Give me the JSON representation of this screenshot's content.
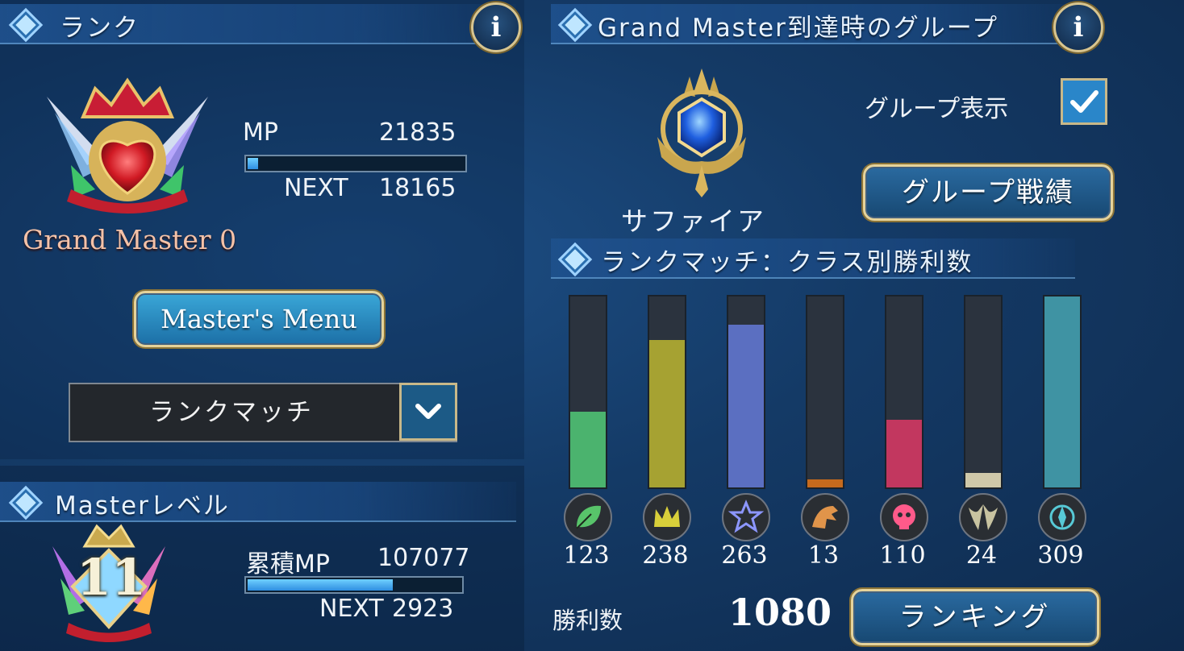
{
  "rank_panel": {
    "title": "ランク",
    "rank_name": "Grand Master 0",
    "mp_label": "MP",
    "mp_value": "21835",
    "mp_progress": 0.05,
    "next_label": "NEXT",
    "next_value": "18165",
    "masters_menu_button": "Master's Menu",
    "match_select_value": "ランクマッチ"
  },
  "master_level": {
    "title": "Masterレベル",
    "level": "11",
    "cumulative_mp_label": "累積MP",
    "cumulative_mp_value": "107077",
    "progress": 0.68,
    "next_label": "NEXT",
    "next_value": "2923"
  },
  "group_panel": {
    "title": "Grand Master到達時のグループ",
    "group_name": "サファイア",
    "group_display_label": "グループ表示",
    "group_display_checked": true,
    "group_record_button": "グループ戦績"
  },
  "class_wins": {
    "title": "ランクマッチ：クラス別勝利数",
    "wins_label": "勝利数",
    "wins_total": "1080",
    "ranking_button": "ランキング"
  },
  "chart_data": {
    "type": "bar",
    "categories": [
      "forest",
      "sword",
      "rune",
      "dragon",
      "shadow",
      "blood",
      "haven"
    ],
    "values": [
      123,
      238,
      263,
      13,
      110,
      24,
      309
    ],
    "colors": [
      "#4bb36e",
      "#a6a232",
      "#5b6fc1",
      "#c56a1d",
      "#c2375f",
      "#cfc8a9",
      "#3f93a3"
    ],
    "icons": [
      "leaf-icon",
      "crown-icon",
      "rune-star-icon",
      "dragon-icon",
      "skull-icon",
      "bat-wing-icon",
      "haven-icon"
    ],
    "ylim": [
      0,
      309
    ]
  }
}
